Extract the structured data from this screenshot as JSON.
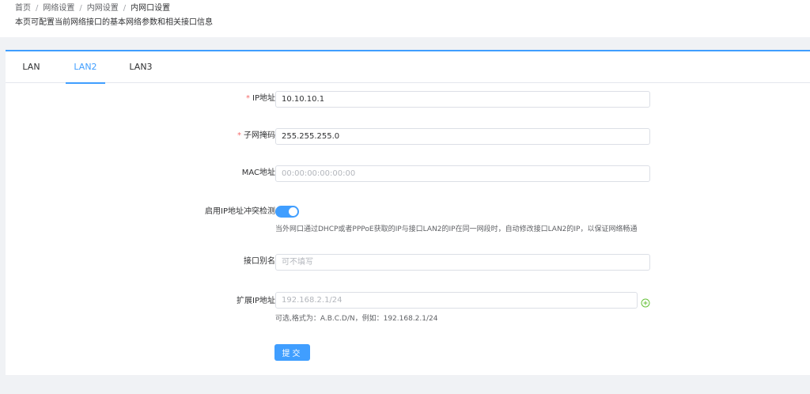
{
  "breadcrumb": {
    "items": [
      "首页",
      "网络设置",
      "内网设置",
      "内网口设置"
    ]
  },
  "page_description": "本页可配置当前网络接口的基本网络参数和相关接口信息",
  "tabs": [
    {
      "label": "LAN",
      "active": false
    },
    {
      "label": "LAN2",
      "active": true
    },
    {
      "label": "LAN3",
      "active": false
    }
  ],
  "form": {
    "ip": {
      "label": "IP地址",
      "required": true,
      "value": "10.10.10.1"
    },
    "subnet": {
      "label": "子网掩码",
      "required": true,
      "value": "255.255.255.0"
    },
    "mac": {
      "label": "MAC地址",
      "placeholder": "00:00:00:00:00:00"
    },
    "conflict_detection": {
      "label": "启用IP地址冲突检测",
      "enabled": true,
      "hint": "当外网口通过DHCP或者PPPoE获取的IP与接口LAN2的IP在同一网段时，自动修改接口LAN2的IP，以保证网络畅通"
    },
    "alias": {
      "label": "接口别名",
      "placeholder": "可不填写"
    },
    "ext_ip": {
      "label": "扩展IP地址",
      "placeholder": "192.168.2.1/24",
      "hint": "可选,格式为：A.B.C.D/N，例如：192.168.2.1/24"
    },
    "submit_label": "提交"
  },
  "colors": {
    "primary": "#409eff",
    "required": "#f56c6c",
    "add_icon": "#67c23a"
  },
  "icons": {
    "add": "plus-circle-icon"
  }
}
